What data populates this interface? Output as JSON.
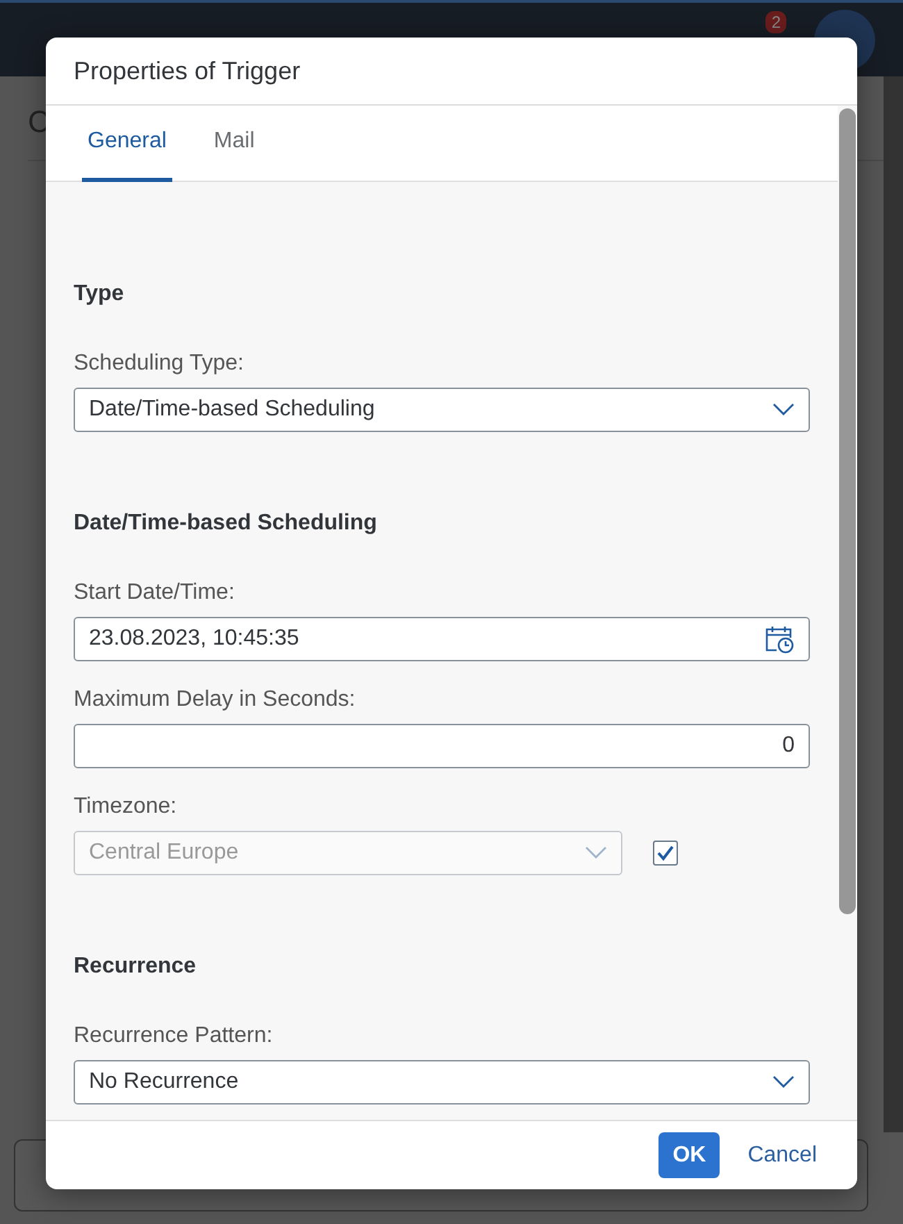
{
  "shell": {
    "notification_count": "2",
    "page_title": "C"
  },
  "dialog": {
    "title": "Properties of Trigger",
    "tabs": [
      {
        "label": "General",
        "selected": true
      },
      {
        "label": "Mail",
        "selected": false
      }
    ],
    "sections": [
      {
        "heading": "Type",
        "fields": [
          {
            "kind": "select",
            "label": "Scheduling Type:",
            "value": "Date/Time-based Scheduling",
            "disabled": false
          }
        ]
      },
      {
        "heading": "Date/Time-based Scheduling",
        "fields": [
          {
            "kind": "datetime",
            "label": "Start Date/Time:",
            "value": "23.08.2023, 10:45:35",
            "disabled": false
          },
          {
            "kind": "number",
            "label": "Maximum Delay in Seconds:",
            "value": "0",
            "disabled": false
          },
          {
            "kind": "select",
            "label": "Timezone:",
            "value": "Central Europe",
            "disabled": true,
            "checkbox": {
              "checked": true
            }
          }
        ]
      },
      {
        "heading": "Recurrence",
        "fields": [
          {
            "kind": "select",
            "label": "Recurrence Pattern:",
            "value": "No Recurrence",
            "disabled": false
          }
        ]
      }
    ],
    "buttons": [
      {
        "label": "OK",
        "kind": "primary"
      },
      {
        "label": "Cancel",
        "kind": "transparent"
      }
    ]
  }
}
